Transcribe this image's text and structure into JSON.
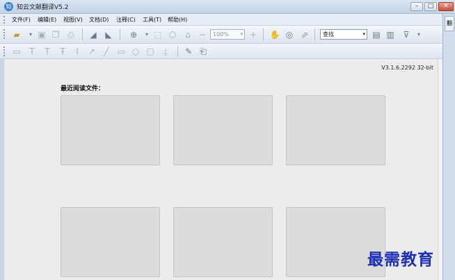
{
  "window": {
    "title": "知云文献翻译V5.2",
    "app_icon_glyph": "知",
    "buttons": {
      "minimize": "–",
      "maximize": "□",
      "close": "✕"
    }
  },
  "menu": {
    "items": [
      "文件(F)",
      "编辑(E)",
      "视图(V)",
      "文档(D)",
      "注释(C)",
      "工具(T)",
      "帮助(H)"
    ]
  },
  "toolbar": {
    "zoom_value": "100%",
    "search_value": "查找",
    "icons": [
      "open-folder-icon",
      "save-icon",
      "copy-icon",
      "print-icon",
      "highlight-icon",
      "eraser-icon",
      "zoom-in-icon",
      "crop-icon",
      "shape-icon",
      "home-icon",
      "zoom-out-icon",
      "zoom-plus-icon",
      "hand-icon",
      "snapshot-icon",
      "select-icon",
      "page-icon",
      "document-icon",
      "filter-icon"
    ]
  },
  "annotation_toolbar": {
    "icons": [
      "note-icon",
      "text-icon",
      "text-icon",
      "strikethrough-icon",
      "text-cursor-icon",
      "arrow-icon",
      "line-icon",
      "rectangle-icon",
      "circle-icon",
      "edit-box-icon",
      "stamp-icon",
      "page-edit-icon",
      "attach-icon"
    ]
  },
  "side_panel": {
    "tab": "翻"
  },
  "content": {
    "version": "V3.1.6.2292 32-bit",
    "recent_title": "最近阅读文件：",
    "thumbnails": 6
  },
  "watermark": "最需教育",
  "colors": {
    "chrome": "#c9d6e6",
    "content_bg": "#ececec",
    "thumb_bg": "#dcdcdc",
    "watermark": "#1c2fb8"
  }
}
